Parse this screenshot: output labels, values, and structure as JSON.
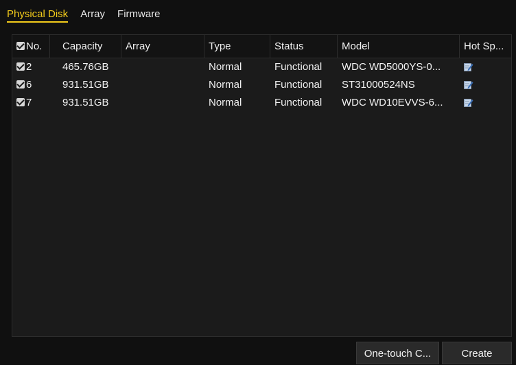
{
  "tabs": [
    {
      "label": "Physical Disk",
      "active": true
    },
    {
      "label": "Array",
      "active": false
    },
    {
      "label": "Firmware",
      "active": false
    }
  ],
  "table": {
    "columns": [
      "No.",
      "Capacity",
      "Array",
      "Type",
      "Status",
      "Model",
      "Hot Sp..."
    ],
    "header_checked": true,
    "rows": [
      {
        "checked": true,
        "no": "2",
        "capacity": "465.76GB",
        "array": "",
        "type": "Normal",
        "status": "Functional",
        "model": "WDC WD5000YS-0...",
        "hot_spare_icon": "edit-icon"
      },
      {
        "checked": true,
        "no": "6",
        "capacity": "931.51GB",
        "array": "",
        "type": "Normal",
        "status": "Functional",
        "model": "ST31000524NS",
        "hot_spare_icon": "edit-icon"
      },
      {
        "checked": true,
        "no": "7",
        "capacity": "931.51GB",
        "array": "",
        "type": "Normal",
        "status": "Functional",
        "model": "WDC WD10EVVS-6...",
        "hot_spare_icon": "edit-icon"
      }
    ]
  },
  "buttons": {
    "one_touch": "One-touch C...",
    "create": "Create"
  },
  "colors": {
    "accent": "#f4cc1b",
    "background": "#101010",
    "panel": "#1b1b1b"
  }
}
